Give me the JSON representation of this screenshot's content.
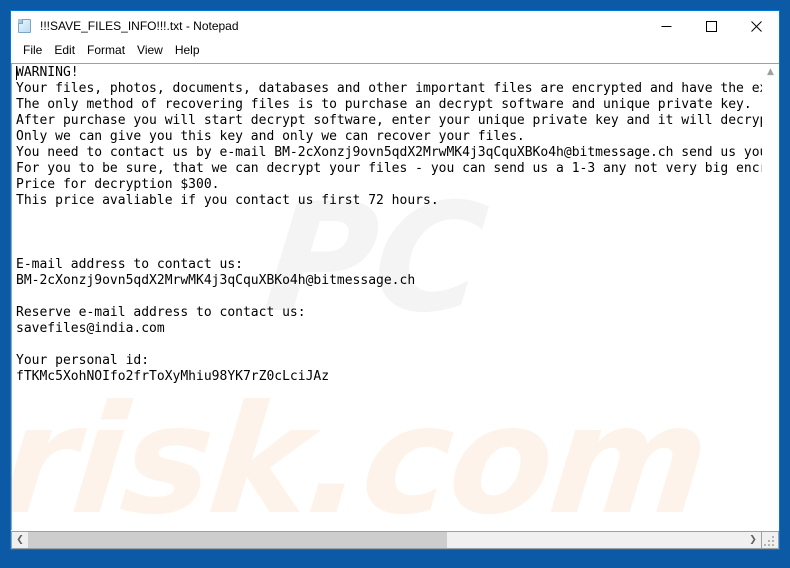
{
  "window": {
    "title": "!!!SAVE_FILES_INFO!!!.txt - Notepad",
    "icon": "notepad-document-icon",
    "accent_color": "#0078d7",
    "desktop_color": "#0c5aa6",
    "controls": {
      "minimize": "minimize-icon",
      "maximize": "maximize-icon",
      "close": "close-icon"
    }
  },
  "menubar": {
    "items": [
      {
        "label": "File"
      },
      {
        "label": "Edit"
      },
      {
        "label": "Format"
      },
      {
        "label": "View"
      },
      {
        "label": "Help"
      }
    ]
  },
  "document": {
    "lines": [
      "WARNING!",
      "Your files, photos, documents, databases and other important files are encrypted and have the exte",
      "The only method of recovering files is to purchase an decrypt software and unique private key.",
      "After purchase you will start decrypt software, enter your unique private key and it will decrypt",
      "Only we can give you this key and only we can recover your files.",
      "You need to contact us by e-mail BM-2cXonzj9ovn5qdX2MrwMK4j3qCquXBKo4h@bitmessage.ch send us your",
      "For you to be sure, that we can decrypt your files - you can send us a 1-3 any not very big encryp",
      "Price for decryption $300.",
      "This price avaliable if you contact us first 72 hours.",
      "",
      "",
      "",
      "E-mail address to contact us:",
      "BM-2cXonzj9ovn5qdX2MrwMK4j3qCquXBKo4h@bitmessage.ch",
      "",
      "Reserve e-mail address to contact us:",
      "savefiles@india.com",
      "",
      "Your personal id:",
      "fTKMc5XohNOIfo2frToXyMhiu98YK7rZ0cLciJAz"
    ]
  },
  "watermark": {
    "top_text": "PC",
    "bottom_text": "risk.com",
    "top_color": "#f4f4f4",
    "bottom_color": "#fdf3ea"
  },
  "scrollbars": {
    "vertical": {
      "up_arrow": "chevron-up-icon",
      "thumb_visible": false
    },
    "horizontal": {
      "left_arrow": "chevron-left-icon",
      "right_arrow": "chevron-right-icon",
      "thumb_percent": 58.5
    }
  }
}
